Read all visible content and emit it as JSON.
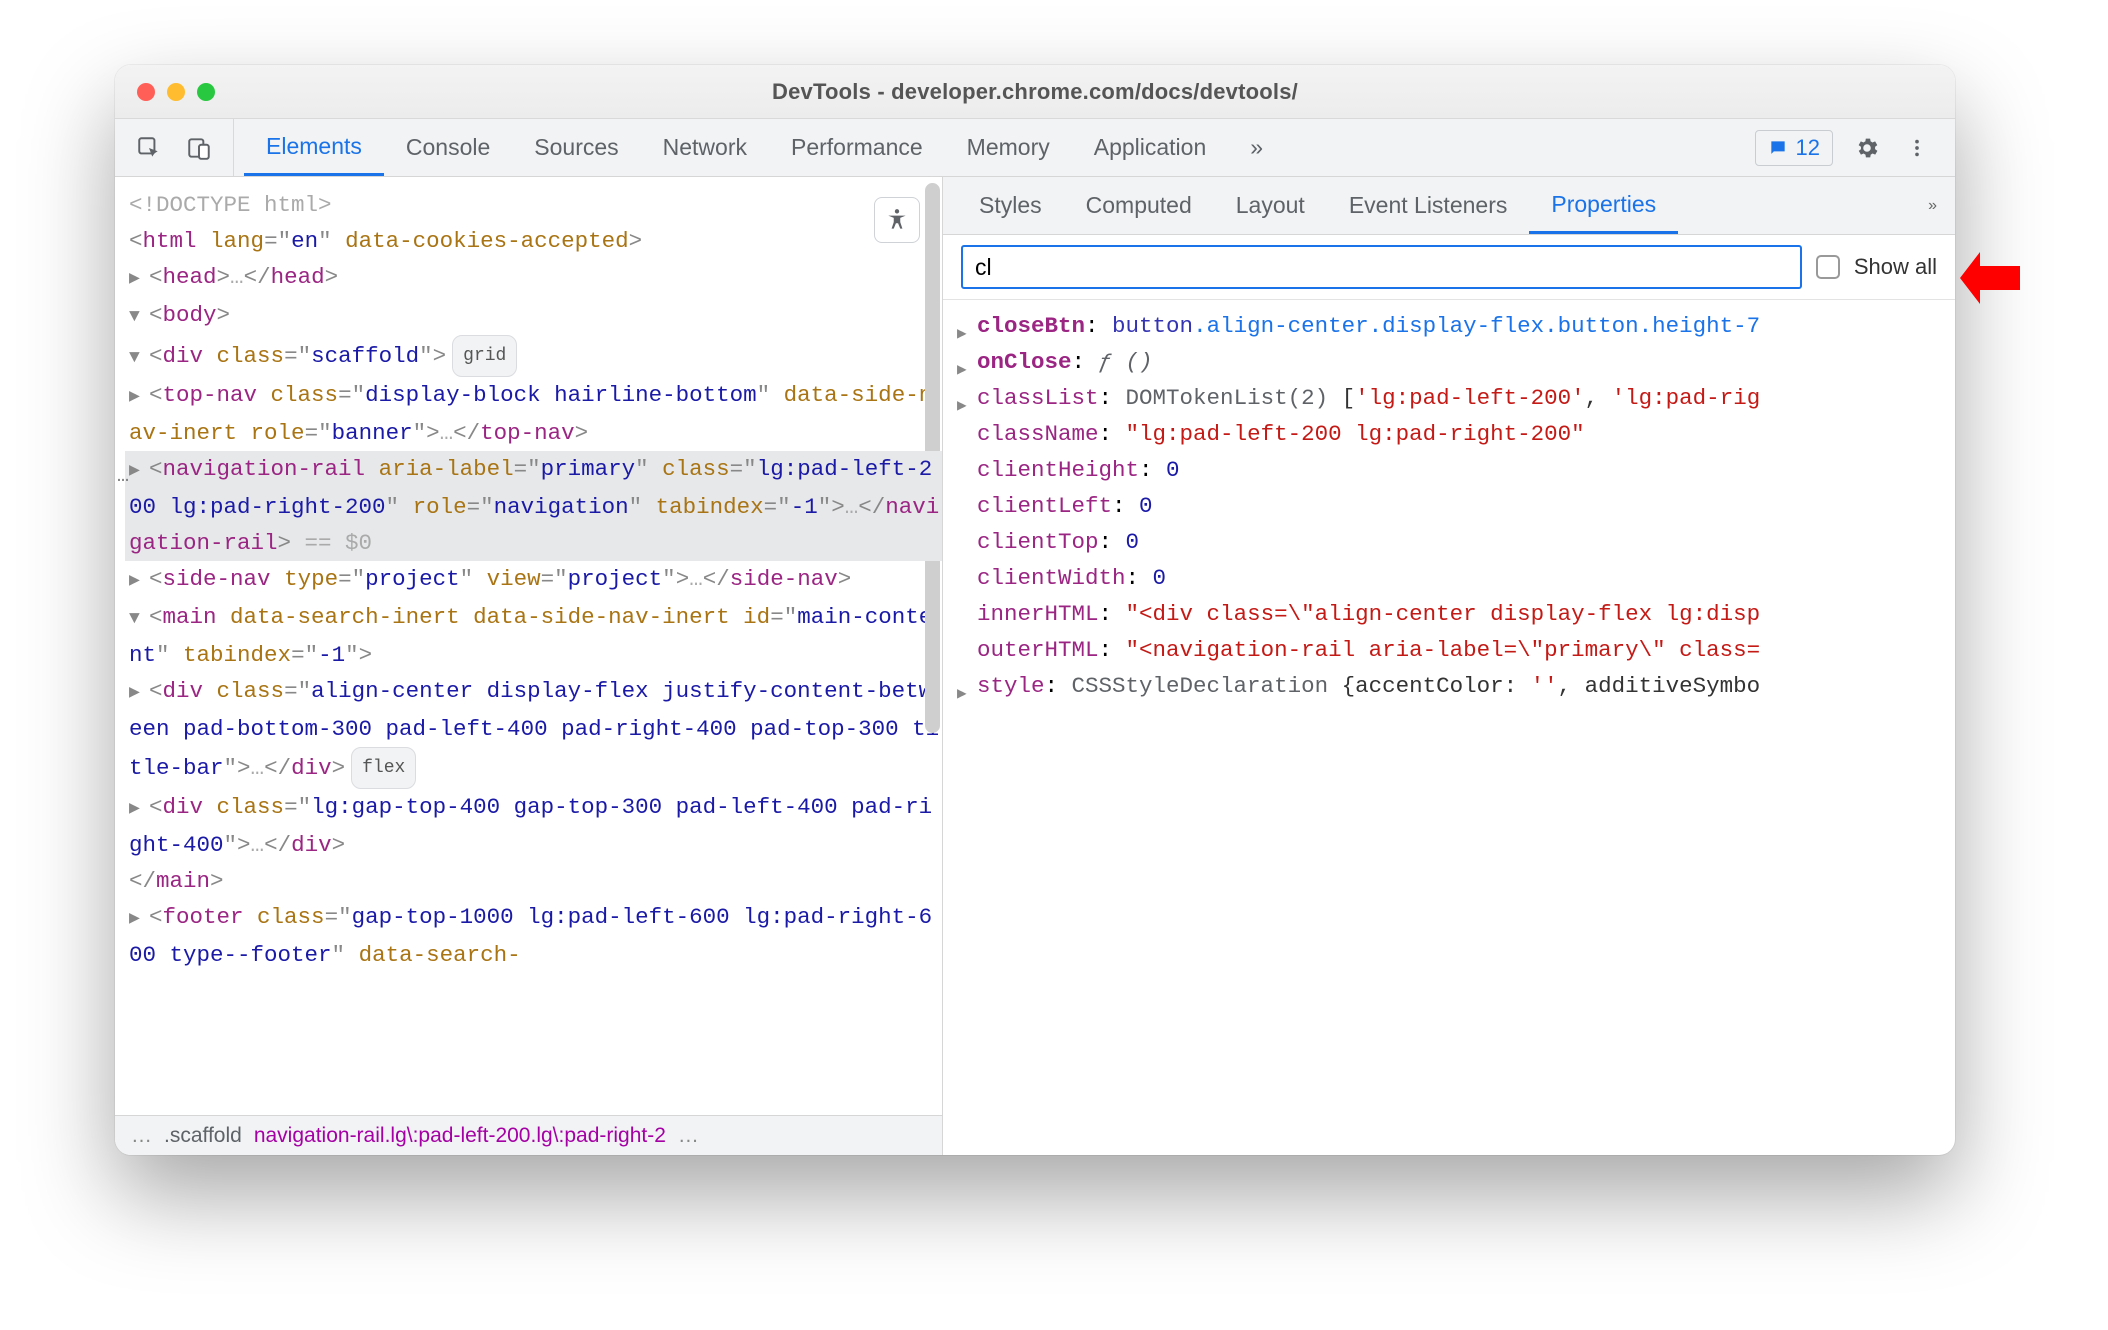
{
  "window": {
    "title": "DevTools - developer.chrome.com/docs/devtools/"
  },
  "toolbar": {
    "tabs": [
      "Elements",
      "Console",
      "Sources",
      "Network",
      "Performance",
      "Memory",
      "Application"
    ],
    "active_tab": "Elements",
    "issues_count": "12"
  },
  "a11y_button_title": "Accessibility",
  "dom": {
    "l0": {
      "raw": "<!DOCTYPE html>"
    },
    "l1": {
      "open": "<",
      "tag": "html",
      "sp": " ",
      "a1": "lang",
      "eq": "=\"",
      "v1": "en",
      "cq": "\" ",
      "a2": "data-cookies-accepted",
      "close": ">"
    },
    "l2": {
      "arrow": "▶",
      "open": "<",
      "tag": "head",
      "close": ">",
      "ell": "…",
      "copen": "</",
      "ctag": "head",
      "cclose": ">"
    },
    "l3": {
      "arrow": "▼",
      "open": "<",
      "tag": "body",
      "close": ">"
    },
    "l4": {
      "arrow": "▼",
      "open": "<",
      "tag": "div",
      "sp": " ",
      "a1": "class",
      "eq": "=\"",
      "v1": "scaffold",
      "cq": "\"",
      "close": ">",
      "pill": "grid"
    },
    "l5": {
      "arrow": "▶",
      "open": "<",
      "tag": "top-nav",
      "sp": " ",
      "a1": "class",
      "eq": "=\"",
      "v1": "display-block hairline-bottom",
      "cq": "\" ",
      "a2": "data-side-nav-inert",
      "sp2": " ",
      "a3": "role",
      "eq3": "=\"",
      "v3": "banner",
      "cq3": "\"",
      "close": ">",
      "ell": "…",
      "copen": "</",
      "ctag": "top-nav",
      "cclose": ">"
    },
    "l6": {
      "arrow": "▶",
      "open": "<",
      "tag": "navigation-rail",
      "sp": " ",
      "a1": "aria-label",
      "eq": "=\"",
      "v1": "primary",
      "cq": "\" ",
      "a2": "class",
      "eq2": "=\"",
      "v2": "lg:pad-left-200 lg:pad-right-200",
      "cq2": "\" ",
      "a3": "role",
      "eq3": "=\"",
      "v3": "navigation",
      "cq3": "\" ",
      "a4": "tabindex",
      "eq4": "=\"",
      "v4": "-1",
      "cq4": "\"",
      "close": ">",
      "ell": "…",
      "copen": "</",
      "ctag": "navigation-rail",
      "cclose": ">",
      "eqsel": " == $0"
    },
    "l7": {
      "arrow": "▶",
      "open": "<",
      "tag": "side-nav",
      "sp": " ",
      "a1": "type",
      "eq": "=\"",
      "v1": "project",
      "cq": "\" ",
      "a2": "view",
      "eq2": "=\"",
      "v2": "project",
      "cq2": "\"",
      "close": ">",
      "ell": "…",
      "copen": "</",
      "ctag": "side-nav",
      "cclose": ">"
    },
    "l8": {
      "arrow": "▼",
      "open": "<",
      "tag": "main",
      "sp": " ",
      "a1": "data-search-inert",
      "sp2": " ",
      "a2": "data-side-nav-inert",
      "sp3": " ",
      "a3": "id",
      "eq3": "=\"",
      "v3": "main-content",
      "cq3": "\" ",
      "a4": "tabindex",
      "eq4": "=\"",
      "v4": "-1",
      "cq4": "\"",
      "close": ">"
    },
    "l9": {
      "arrow": "▶",
      "open": "<",
      "tag": "div",
      "sp": " ",
      "a1": "class",
      "eq": "=\"",
      "v1": "align-center display-flex justify-content-between pad-bottom-300 pad-left-400 pad-right-400 pad-top-300 title-bar",
      "cq": "\"",
      "close": ">",
      "ell": "…",
      "copen": "</",
      "ctag": "div",
      "cclose": ">",
      "pill": "flex"
    },
    "l10": {
      "arrow": "▶",
      "open": "<",
      "tag": "div",
      "sp": " ",
      "a1": "class",
      "eq": "=\"",
      "v1": "lg:gap-top-400 gap-top-300 pad-left-400 pad-right-400",
      "cq": "\"",
      "close": ">",
      "ell": "…",
      "copen": "</",
      "ctag": "div",
      "cclose": ">"
    },
    "l11": {
      "copen": "</",
      "ctag": "main",
      "cclose": ">"
    },
    "l12": {
      "arrow": "▶",
      "open": "<",
      "tag": "footer",
      "sp": " ",
      "a1": "class",
      "eq": "=\"",
      "v1": "gap-top-1000 lg:pad-left-600 lg:pad-right-600 type--footer",
      "cq": "\" ",
      "a2": "data-search-",
      "trunc": ""
    }
  },
  "breadcrumb": {
    "c1": ".scaffold",
    "c2": "navigation-rail.lg\\:pad-left-200.lg\\:pad-right-2"
  },
  "sidepanel": {
    "tabs": [
      "Styles",
      "Computed",
      "Layout",
      "Event Listeners",
      "Properties"
    ],
    "active_tab": "Properties",
    "filter_value": "cl",
    "show_all_label": "Show all",
    "show_all_checked": false
  },
  "props": {
    "p0": {
      "k": "closeBtn",
      "colon": ": ",
      "el": "button",
      "cls": ".align-center.display-flex.button.height-7"
    },
    "p1": {
      "k": "onClose",
      "colon": ": ",
      "fn": "ƒ ()"
    },
    "p2": {
      "k": "classList",
      "colon": ": ",
      "type": "DOMTokenList(2)",
      "brace": " [",
      "s1": "'lg:pad-left-200'",
      "comma": ", ",
      "s2": "'lg:pad-rig"
    },
    "p3": {
      "k": "className",
      "colon": ": ",
      "str": "\"lg:pad-left-200 lg:pad-right-200\""
    },
    "p4": {
      "k": "clientHeight",
      "colon": ": ",
      "num": "0"
    },
    "p5": {
      "k": "clientLeft",
      "colon": ": ",
      "num": "0"
    },
    "p6": {
      "k": "clientTop",
      "colon": ": ",
      "num": "0"
    },
    "p7": {
      "k": "clientWidth",
      "colon": ": ",
      "num": "0"
    },
    "p8": {
      "k": "innerHTML",
      "colon": ": ",
      "str": "\"<div class=\\\"align-center display-flex lg:disp"
    },
    "p9": {
      "k": "outerHTML",
      "colon": ": ",
      "str": "\"<navigation-rail aria-label=\\\"primary\\\" class="
    },
    "p10": {
      "k": "style",
      "colon": ": ",
      "type": "CSSStyleDeclaration ",
      "brace": "{",
      "plain": "accentColor: ",
      "s1": "''",
      "comma": ", ",
      "plain2": "additiveSymbo"
    }
  }
}
